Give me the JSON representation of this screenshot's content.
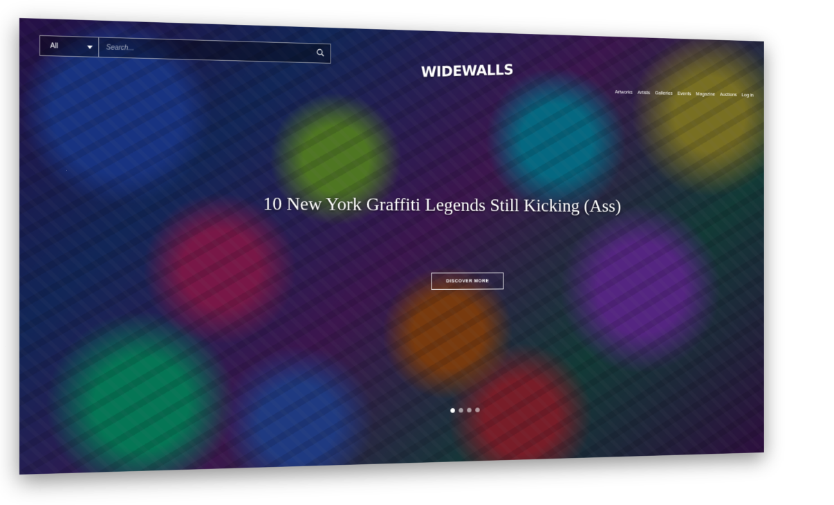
{
  "search": {
    "category_selected": "All",
    "placeholder": "Search..."
  },
  "brand": {
    "logo_text": "WIDEWALLS"
  },
  "nav": {
    "items": [
      "Artworks",
      "Artists",
      "Galleries",
      "Events",
      "Magazine",
      "Auctions",
      "Log in"
    ]
  },
  "hero": {
    "title": "10 New York Graffiti Legends Still Kicking (Ass)",
    "cta_label": "DISCOVER MORE",
    "slide_count": 4,
    "active_slide": 1
  }
}
